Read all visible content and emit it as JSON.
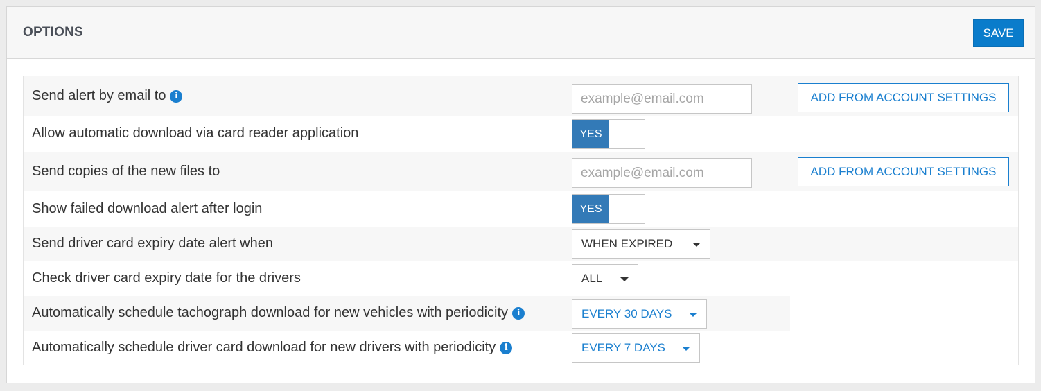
{
  "header": {
    "title": "OPTIONS",
    "save_label": "SAVE"
  },
  "options": {
    "email_alert": {
      "label": "Send alert by email to",
      "info_icon": "info-icon",
      "placeholder": "example@email.com",
      "value": "",
      "button_label": "ADD FROM ACCOUNT SETTINGS"
    },
    "auto_download": {
      "label": "Allow automatic download via card reader application",
      "toggle_label": "YES"
    },
    "send_copies": {
      "label": "Send copies of the new files to",
      "placeholder": "example@email.com",
      "value": "",
      "button_label": "ADD FROM ACCOUNT SETTINGS"
    },
    "failed_alert": {
      "label": "Show failed download alert after login",
      "toggle_label": "YES"
    },
    "expiry_alert": {
      "label": "Send driver card expiry date alert when",
      "selected": "WHEN EXPIRED"
    },
    "expiry_check": {
      "label": "Check driver card expiry date for the drivers",
      "selected": "ALL"
    },
    "tacho_schedule": {
      "label": "Automatically schedule tachograph download for new vehicles with periodicity",
      "info_icon": "info-icon",
      "selected": "EVERY 30 DAYS"
    },
    "card_schedule": {
      "label": "Automatically schedule driver card download for new drivers with periodicity",
      "info_icon": "info-icon",
      "selected": "EVERY 7 DAYS"
    }
  },
  "colors": {
    "accent": "#0a7ccb",
    "link_blue": "#1a7fcf",
    "toggle_on": "#337ab7",
    "row_shade": "#f7f7f7",
    "page_bg": "#ececec"
  }
}
